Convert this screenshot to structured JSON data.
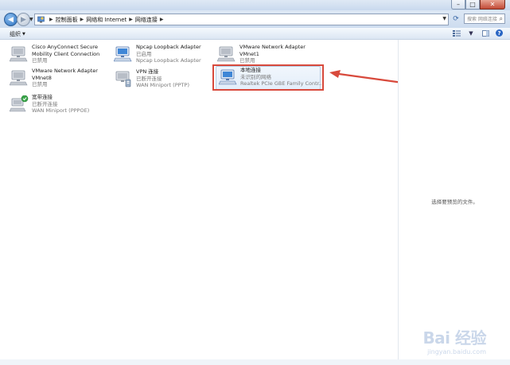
{
  "window": {
    "caption_min": "–",
    "caption_max": "□",
    "caption_close": "✕"
  },
  "address": {
    "crumbs": [
      "控制面板",
      "网络和 Internet",
      "网络连接"
    ],
    "search_placeholder": "搜索 网络连接"
  },
  "toolbar": {
    "organize_label": "组织"
  },
  "adapters": [
    {
      "name": "Cisco AnyConnect Secure",
      "name2": "Mobility Client Connection",
      "status": "已禁用",
      "device": "",
      "icon": "network-adapter-disabled-icon"
    },
    {
      "name": "Npcap Loopback Adapter",
      "name2": "",
      "status": "已启用",
      "device": "Npcap Loopback Adapter",
      "icon": "network-adapter-icon"
    },
    {
      "name": "VMware Network Adapter",
      "name2": "VMnet1",
      "status": "已禁用",
      "device": "",
      "icon": "network-adapter-disabled-icon"
    },
    {
      "name": "VMware Network Adapter",
      "name2": "VMnet8",
      "status": "已禁用",
      "device": "",
      "icon": "network-adapter-disabled-icon"
    },
    {
      "name": "VPN 连接",
      "name2": "",
      "status": "已断开连接",
      "device": "WAN Miniport (PPTP)",
      "icon": "vpn-connection-icon"
    },
    {
      "name": "本地连接",
      "name2": "",
      "status": "未识别的网络",
      "device": "Realtek PCIe GBE Family Contr...",
      "icon": "local-area-connection-icon"
    },
    {
      "name": "宽带连接",
      "name2": "",
      "status": "已断开连接",
      "device": "WAN Miniport (PPPOE)",
      "icon": "broadband-connection-icon"
    }
  ],
  "preview": {
    "text": "选择要预览的文件。"
  },
  "watermark": {
    "logo": "Bai 经验",
    "url": "jingyan.baidu.com"
  },
  "colors": {
    "highlight": "#d84a3c",
    "accent": "#2a66c4"
  }
}
